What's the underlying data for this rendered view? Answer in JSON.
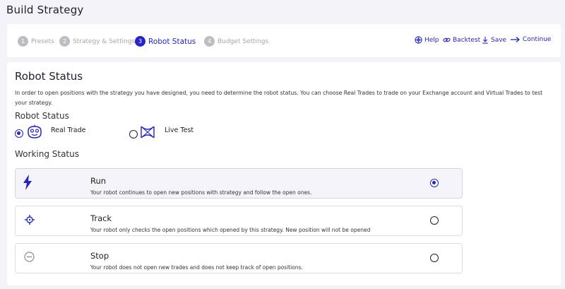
{
  "page": {
    "title": "Build Strategy"
  },
  "steps": [
    {
      "number": "1",
      "label": "Presets",
      "active": false
    },
    {
      "number": "2",
      "label": "Strategy & Settings",
      "active": false
    },
    {
      "number": "3",
      "label": "Robot Status",
      "active": true
    },
    {
      "number": "4",
      "label": "Budget Settings",
      "active": false
    }
  ],
  "actions": {
    "help": "Help",
    "backtest": "Backtest",
    "save": "Save",
    "continue": "Continue"
  },
  "colors": {
    "accent": "#2424c8",
    "inactive_step": "#bdbdc4"
  },
  "robot_status": {
    "heading": "Robot Status",
    "description": "In order to open positions with the strategy you have designed, you need to determine the robot status. You can choose Real Trades to trade on your Exchange account and Virtual Trades to test your strategy.",
    "subheading": "Robot Status",
    "options": [
      {
        "label": "Real Trade",
        "icon": "robot-face-icon",
        "selected": true
      },
      {
        "label": "Live Test",
        "icon": "crossed-loop-icon",
        "selected": false
      }
    ]
  },
  "working_status": {
    "subheading": "Working Status",
    "options": [
      {
        "title": "Run",
        "description": "Your robot continues to open new positions with strategy and follow the open ones.",
        "icon": "lightning-icon",
        "selected": true
      },
      {
        "title": "Track",
        "description": "Your robot only checks the open positions which opened by this strategy. New position will not be opened",
        "icon": "crosshair-icon",
        "selected": false
      },
      {
        "title": "Stop",
        "description": "Your robot does not open new trades and does not keep track of open positions.",
        "icon": "minus-circle-icon",
        "selected": false
      }
    ]
  }
}
